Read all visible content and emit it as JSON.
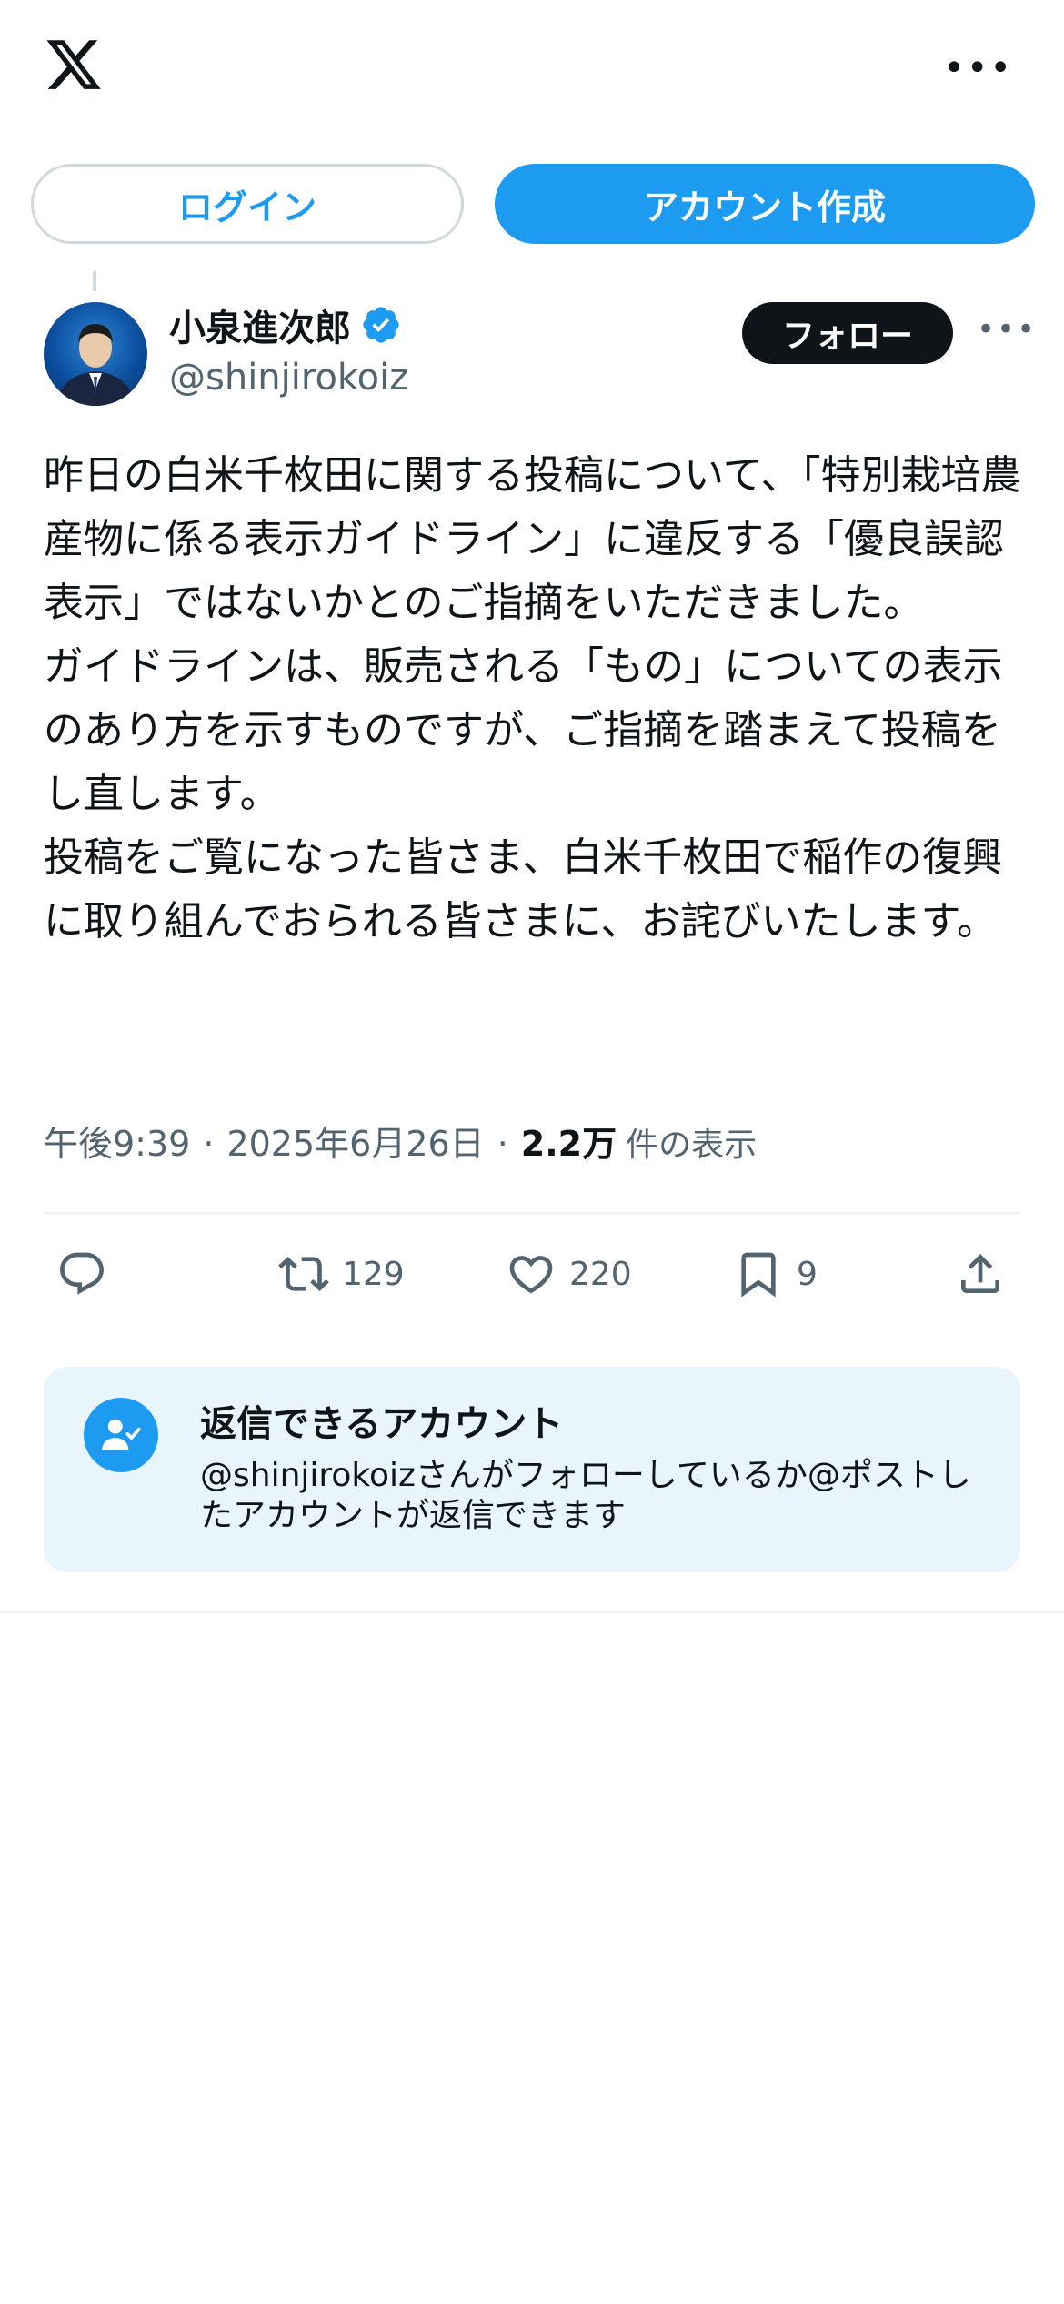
{
  "header": {
    "logo_icon": "x-logo-icon",
    "more_icon": "more-horizontal-icon"
  },
  "auth": {
    "login_label": "ログイン",
    "signup_label": "アカウント作成"
  },
  "post": {
    "author_name": "小泉進次郎",
    "author_handle": "@shinjirokoiz",
    "verified_icon": "verified-badge-icon",
    "follow_label": "フォロー",
    "text": "昨日の白米千枚田に関する投稿について、「特別栽培農産物に係る表示ガイドライン」に違反する「優良誤認表示」ではないかとのご指摘をいただきました。\nガイドラインは、販売される「もの」についての表示のあり方を示すものですが、ご指摘を踏まえて投稿をし直します。\n投稿をご覧になった皆さま、白米千枚田で稲作の復興に取り組んでおられる皆さまに、お詫びいたします。",
    "time": "午後9:39",
    "date": "2025年6月26日",
    "separator": "·",
    "views": "2.2万",
    "views_label": "件の表示"
  },
  "actions": {
    "reply_count": "",
    "retweet_count": "129",
    "like_count": "220",
    "bookmark_count": "9"
  },
  "reply_restriction": {
    "title": "返信できるアカウント",
    "description": "@shinjirokoizさんがフォローしているか@ポストしたアカウントが返信できます"
  },
  "colors": {
    "accent": "#1d9bf0",
    "text": "#0f1419",
    "secondary": "#536471",
    "info_bg": "#e8f5fd"
  }
}
